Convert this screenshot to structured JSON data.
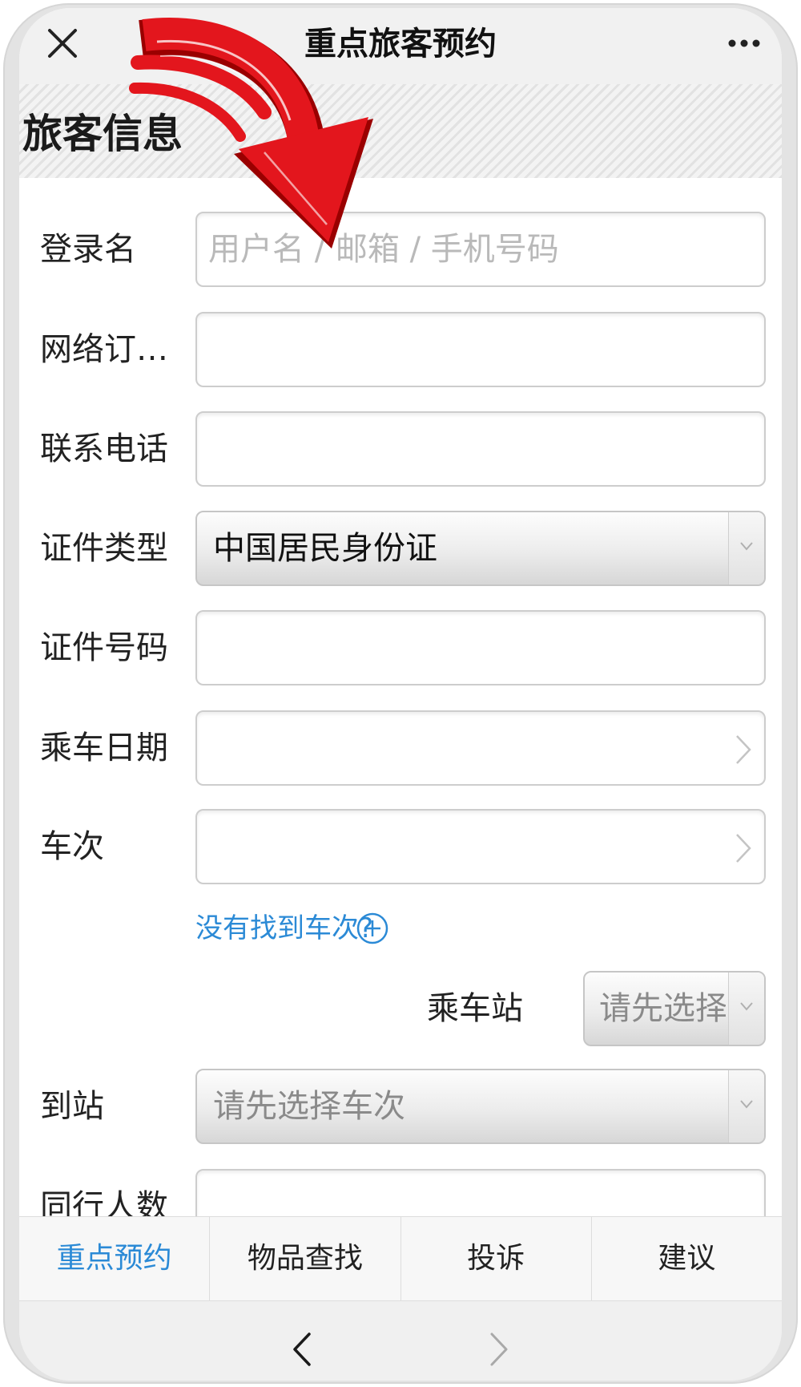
{
  "nav": {
    "title": "重点旅客预约",
    "left_icon": "close-icon",
    "right_icon": "more-icon"
  },
  "section_title": "旅客信息",
  "form": {
    "login_name": {
      "label": "登录名",
      "placeholder": "用户名 / 邮箱 / 手机号码"
    },
    "order_no": {
      "label": "网络订…"
    },
    "phone": {
      "label": "联系电话"
    },
    "id_type": {
      "label": "证件类型",
      "value": "中国居民身份证",
      "icon": "chevron-down-icon"
    },
    "id_number": {
      "label": "证件号码"
    },
    "travel_date": {
      "label": "乘车日期",
      "icon": "chevron-right-icon"
    },
    "train_no": {
      "label": "车次",
      "icon": "chevron-right-icon"
    },
    "no_train_link": "没有找到车次?",
    "no_train_icon": "plus-circle-icon",
    "boarding_station": {
      "label": "乘车站",
      "value": "请先选择车次"
    },
    "arrival_station": {
      "label": "到站",
      "value": "请先选择车次"
    },
    "companions": {
      "label": "同行人数"
    }
  },
  "tabs": {
    "items": [
      "重点预约",
      "物品查找",
      "投诉",
      "建议"
    ],
    "active_index": 0
  },
  "bottom_nav": {
    "back_icon": "chevron-left-icon",
    "forward_icon": "chevron-right-icon"
  },
  "annotation_icon": "red-arrow-icon",
  "colors": {
    "accent": "#2b8ad6",
    "arrow": "#e3161d"
  }
}
